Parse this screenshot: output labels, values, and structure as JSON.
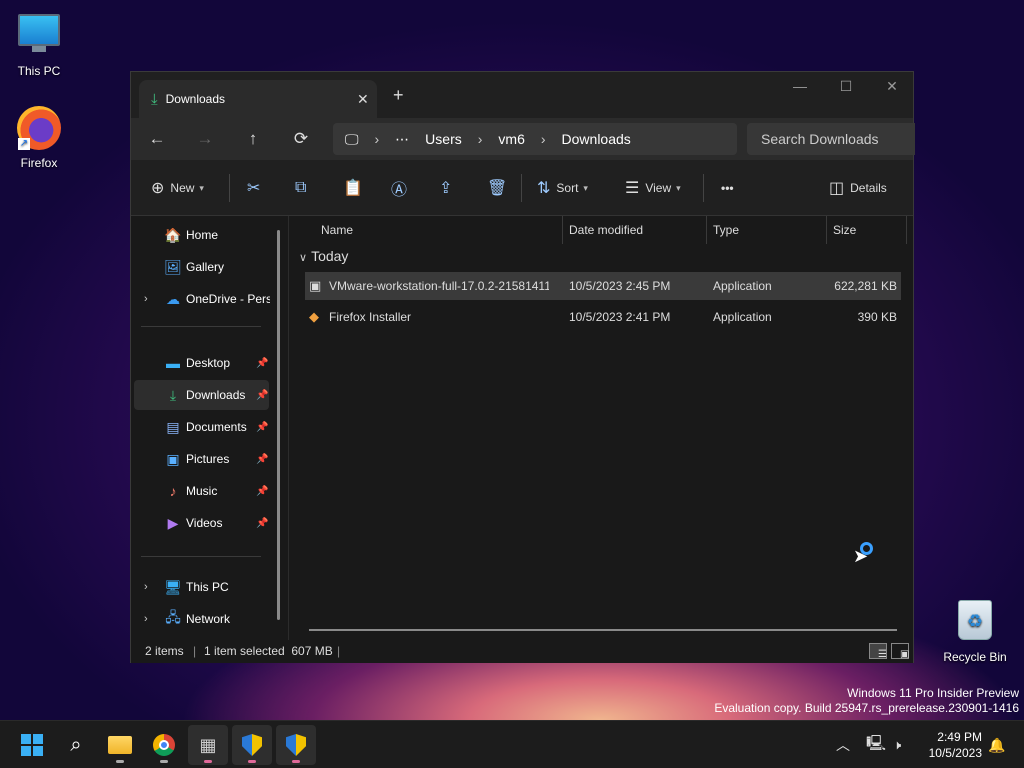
{
  "desktop": {
    "icons": [
      {
        "label": "This PC"
      },
      {
        "label": "Firefox"
      },
      {
        "label": "Recycle Bin"
      }
    ],
    "watermark": {
      "line1": "Windows 11 Pro Insider Preview",
      "line2": "Evaluation copy. Build 25947.rs_prerelease.230901-1416"
    }
  },
  "window": {
    "tab": {
      "title": "Downloads",
      "close": "✕",
      "new": "+"
    },
    "controls": {
      "minimize": "—",
      "maximize": "☐",
      "close": "✕"
    },
    "nav": {
      "back": "←",
      "forward": "→",
      "up": "↑",
      "refresh": "⟳"
    },
    "breadcrumb": {
      "more": "⋯",
      "items": [
        "Users",
        "vm6",
        "Downloads"
      ]
    },
    "search": {
      "placeholder": "Search Downloads"
    },
    "toolbar": {
      "new_label": "New",
      "sort_label": "Sort",
      "view_label": "View",
      "more_label": "•••",
      "details_label": "Details"
    },
    "sidebar": {
      "items": [
        {
          "label": "Home"
        },
        {
          "label": "Gallery"
        },
        {
          "label": "OneDrive - Personal"
        },
        {
          "label": "Desktop"
        },
        {
          "label": "Downloads"
        },
        {
          "label": "Documents"
        },
        {
          "label": "Pictures"
        },
        {
          "label": "Music"
        },
        {
          "label": "Videos"
        },
        {
          "label": "This PC"
        },
        {
          "label": "Network"
        }
      ]
    },
    "columns": {
      "name": "Name",
      "date": "Date modified",
      "type": "Type",
      "size": "Size"
    },
    "group": "Today",
    "files": [
      {
        "name": "VMware-workstation-full-17.0.2-21581411",
        "date": "10/5/2023 2:45 PM",
        "type": "Application",
        "size": "622,281 KB"
      },
      {
        "name": "Firefox Installer",
        "date": "10/5/2023 2:41 PM",
        "type": "Application",
        "size": "390 KB"
      }
    ],
    "status": {
      "items": "2 items",
      "selected": "1 item selected  607 MB"
    }
  },
  "taskbar": {
    "time": "2:49 PM",
    "date": "10/5/2023"
  }
}
